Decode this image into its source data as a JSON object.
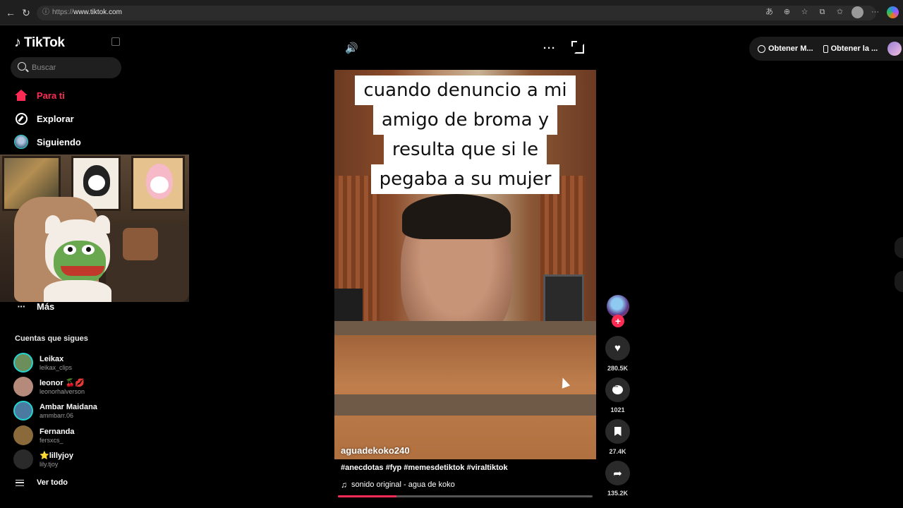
{
  "browser": {
    "url_scheme": "https://",
    "url_host": "www.tiktok.com"
  },
  "sidebar": {
    "brand": "TikTok",
    "search_placeholder": "Buscar",
    "nav": [
      {
        "label": "Para ti",
        "icon": "home-icon",
        "active": true
      },
      {
        "label": "Explorar",
        "icon": "compass-icon",
        "active": false
      },
      {
        "label": "Siguiendo",
        "icon": "avatar",
        "active": false
      },
      {
        "label": "Más",
        "icon": "more-icon",
        "active": false
      }
    ],
    "follows_title": "Cuentas que sigues",
    "accounts": [
      {
        "name": "Leikax",
        "handle": "leikax_clips",
        "color": "#6b8e5a"
      },
      {
        "name": "leonor 🍒💋",
        "handle": "leonorhalverson",
        "color": "#b58a7a"
      },
      {
        "name": "Ambar Maidana",
        "handle": "ammbarr.06",
        "color": "#4b7aa0"
      },
      {
        "name": "Fernanda",
        "handle": "fersxcs_",
        "color": "#8a6a3a"
      },
      {
        "name": "⭐lillyjoy",
        "handle": "lily.tjoy",
        "color": "#2a2a2a"
      }
    ],
    "see_all": "Ver todo"
  },
  "video": {
    "caption_lines": [
      "cuando denuncio a mi",
      "amigo de broma y",
      "resulta que si le",
      "pegaba a su mujer"
    ],
    "username": "aguadekoko240",
    "hashtags": "#anecdotas #fyp #memesdetiktok #viraltiktok",
    "sound": "sonido original - agua de koko",
    "progress": 0.23
  },
  "actions": {
    "likes": "280.5K",
    "comments": "1021",
    "saves": "27.4K",
    "shares": "135.2K",
    "follow_plus": "+"
  },
  "top_right": {
    "get_1": "Obtener M...",
    "get_2": "Obtener la ..."
  },
  "colors": {
    "accent": "#fe2c55",
    "background": "#000000"
  }
}
